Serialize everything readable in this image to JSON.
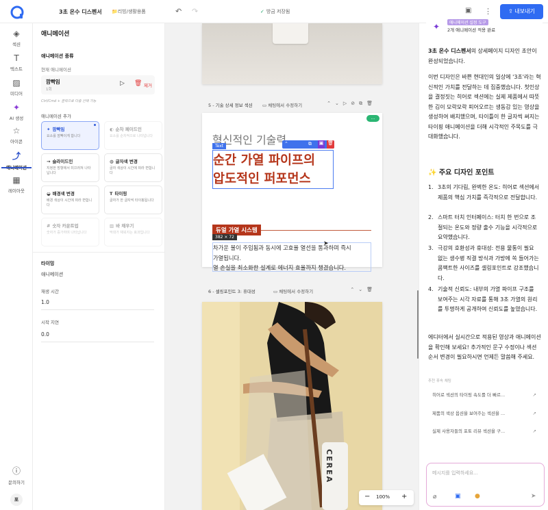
{
  "topbar": {
    "project_title": "3초 온수 디스펜서",
    "breadcrumb": "리빙/생활용품",
    "save_status": "방금 저장됨",
    "export_label": "내보내기",
    "accent_color": "#2f6bf2"
  },
  "rail": {
    "items": [
      {
        "label": "섹션",
        "icon": "layers-icon"
      },
      {
        "label": "텍스트",
        "icon": "text-icon"
      },
      {
        "label": "미디어",
        "icon": "image-icon"
      },
      {
        "label": "AI 생성",
        "icon": "magic-wand-icon"
      },
      {
        "label": "아이콘",
        "icon": "star-icon"
      },
      {
        "label": "애니메이션",
        "icon": "animation-icon"
      },
      {
        "label": "레이아웃",
        "icon": "grid-icon"
      }
    ],
    "help_label": "문의하기",
    "avatar_initial": "포"
  },
  "panel": {
    "title": "애니메이션",
    "type_heading": "애니메이션 종류",
    "current_label": "현재 애니메이션",
    "current_name": "깜빡임",
    "current_order": "1회",
    "remove_label": "제거",
    "shortcut_hint": "Ctrl/Cmd + 클릭으로 다중 선택 가능",
    "add_heading": "애니메이션 추가",
    "cards": [
      {
        "title": "깜빡임",
        "desc": "요소를 깜빡이게 합니다",
        "icon": "sparkle-icon",
        "state": "selected"
      },
      {
        "title": "순차 페이드인",
        "desc": "요소를 순차적으로 나타냅니다",
        "icon": "fade-icon",
        "state": "disabled"
      },
      {
        "title": "슬라이드인",
        "desc": "지정한 방향에서 미끄러져 나타납니다",
        "icon": "arrow-right-icon",
        "state": "normal"
      },
      {
        "title": "글자색 변경",
        "desc": "글자 색상이 시간에 따라 변합니다",
        "icon": "palette-icon",
        "state": "normal"
      },
      {
        "title": "배경색 변경",
        "desc": "배경 색상이 시간에 따라 변합니다",
        "icon": "paint-bucket-icon",
        "state": "normal"
      },
      {
        "title": "타이핑",
        "desc": "글자가 한 글자씩 타이핑됩니다",
        "icon": "text-cursor-icon",
        "state": "normal"
      },
      {
        "title": "숫자 카운트업",
        "desc": "숫자가 증가하며 나타납니다",
        "icon": "hash-icon",
        "state": "disabled"
      },
      {
        "title": "바 채우기",
        "desc": "막대가 채워지는 효과입니다",
        "icon": "bar-chart-icon",
        "state": "disabled"
      }
    ],
    "timing_heading": "타이밍",
    "timing_sub": "애니메이션",
    "duration_label": "재생 시간",
    "duration_value": "1.0",
    "delay_label": "시작 지연",
    "delay_value": "0.0"
  },
  "canvas": {
    "section5": {
      "title": "5 - 기술 상세 정보 섹션",
      "edit_label": "채팅에서 수정하기",
      "eyebrow": "혁신적인 기술력",
      "headline_line1": "순간 가열 파이프의",
      "headline_line2": "압도적인 퍼포먼스",
      "text_tag": "Text",
      "badge": "듀얼 가열 시스템",
      "size_tag": "382 × 72",
      "body_line1": "차가운 물이 주입됨과 동시에 고효율 열선을 통과하며 즉시",
      "body_line2": "가열됩니다.",
      "body_line3": "열 손실을 최소화한 설계로 에너지 효율까지 챙겼습니다.",
      "accent_color": "#b5361b"
    },
    "section6": {
      "title": "6 - 셀링포인트 3: 휴대성",
      "edit_label": "채팅에서 수정하기",
      "bottle_text": "CEREA"
    },
    "zoom": "100%"
  },
  "chat": {
    "tool_title": "애니메이션 설정 도구",
    "tool_status": "2개 애니메이션 적용 완료",
    "intro_strong": "3초 온수 디스펜서",
    "intro_rest": "의 상세페이지 디자인 초안이 완성되었습니다.",
    "para2": "이번 디자인은 바쁜 현대인의 일상에 '3초'라는 혁신적인 가치를 전달하는 데 집중했습니다. 첫인상을 결정짓는 히어로 섹션에는 실제 제품에서 따뜻한 김이 모락모락 피어오르는 생동감 있는 영상을 생성하여 배치했으며, 타이틀이 한 글자씩 써지는 타이핑 애니메이션을 더해 시각적인 주목도를 극대화했습니다.",
    "points_heading": "✨ 주요 디자인 포인트",
    "points": [
      {
        "num": "1.",
        "text": "3초의 기다림, 완벽한 온도: 히어로 섹션에서 제품의 핵심 가치를 즉각적으로 전달합니다."
      },
      {
        "num": "2.",
        "text": "스마트 터치 인터페이스: 터치 한 번으로 조절되는 온도와 정량 출수 기능을 시각적으로 요약했습니다."
      },
      {
        "num": "3.",
        "text": "극강의 호환성과 휴대성: 전용 물통이 필요 없는 생수병 직결 방식과 가방에 쏙 들어가는 콤팩트한 사이즈를 셀링포인트로 강조했습니다."
      },
      {
        "num": "4.",
        "text": "기술적 신뢰도: 내부의 가열 파이프 구조를 보여주는 시각 자료를 통해 3초 가열의 원리를 투명하게 공개하여 신뢰도를 높였습니다."
      }
    ],
    "closing": "에디터에서 실시간으로 적용된 영상과 애니메이션을 확인해 보세요! 추가적인 문구 수정이나 섹션 순서 변경이 필요하시면 언제든 말씀해 주세요.",
    "suggest_heading": "추천 후속 채팅",
    "suggestions": [
      "히어로 섹션의 타이핑 속도를 더 빠르...",
      "제품의 색상 옵션을 보여주는 섹션을 ...",
      "실제 사용자들의 포토 리뷰 섹션을 구..."
    ],
    "input_placeholder": "메시지를 입력하세요..."
  }
}
